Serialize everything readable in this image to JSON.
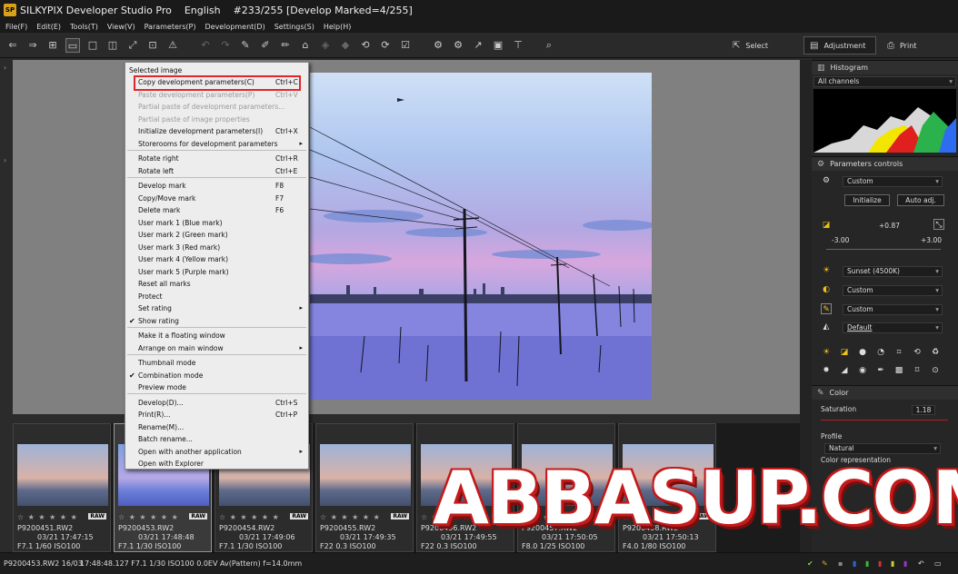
{
  "window": {
    "title": "SILKYPIX Developer Studio Pro",
    "language": "English",
    "image_info": "#233/255 [Develop Marked=4/255]"
  },
  "menubar": [
    "File(F)",
    "Edit(E)",
    "Tools(T)",
    "View(V)",
    "Parameters(P)",
    "Development(D)",
    "Settings(S)",
    "Help(H)"
  ],
  "toolbar": {
    "select_label": "Select",
    "adjustment_label": "Adjustment",
    "print_label": "Print"
  },
  "context_menu": {
    "header": "Selected image",
    "items": [
      {
        "label": "Copy development parameters(C)",
        "shortcut": "Ctrl+C",
        "enabled": true,
        "highlighted": true
      },
      {
        "label": "Paste development parameters(P)",
        "shortcut": "Ctrl+V",
        "enabled": false
      },
      {
        "label": "Partial paste of development parameters...",
        "shortcut": "",
        "enabled": false
      },
      {
        "label": "Partial paste of image properties",
        "shortcut": "",
        "enabled": false
      },
      {
        "label": "Initialize development parameters(I)",
        "shortcut": "Ctrl+X",
        "enabled": true
      },
      {
        "label": "Storerooms for development parameters",
        "shortcut": "",
        "enabled": true,
        "submenu": true
      },
      {
        "label": "Rotate right",
        "shortcut": "Ctrl+R",
        "enabled": true
      },
      {
        "label": "Rotate left",
        "shortcut": "Ctrl+E",
        "enabled": true
      },
      {
        "label": "Develop mark",
        "shortcut": "F8",
        "enabled": true
      },
      {
        "label": "Copy/Move mark",
        "shortcut": "F7",
        "enabled": true
      },
      {
        "label": "Delete mark",
        "shortcut": "F6",
        "enabled": true
      },
      {
        "label": "User mark 1 (Blue mark)",
        "shortcut": "",
        "enabled": true
      },
      {
        "label": "User mark 2 (Green mark)",
        "shortcut": "",
        "enabled": true
      },
      {
        "label": "User mark 3 (Red mark)",
        "shortcut": "",
        "enabled": true
      },
      {
        "label": "User mark 4 (Yellow mark)",
        "shortcut": "",
        "enabled": true
      },
      {
        "label": "User mark 5 (Purple mark)",
        "shortcut": "",
        "enabled": true
      },
      {
        "label": "Reset all marks",
        "shortcut": "",
        "enabled": true
      },
      {
        "label": "Protect",
        "shortcut": "",
        "enabled": true
      },
      {
        "label": "Set rating",
        "shortcut": "",
        "enabled": true,
        "submenu": true
      },
      {
        "label": "Show rating",
        "shortcut": "",
        "enabled": true,
        "checked": true
      },
      {
        "label": "Make it a floating window",
        "shortcut": "",
        "enabled": true
      },
      {
        "label": "Arrange on main window",
        "shortcut": "",
        "enabled": true,
        "submenu": true
      },
      {
        "label": "Thumbnail mode",
        "shortcut": "",
        "enabled": true
      },
      {
        "label": "Combination mode",
        "shortcut": "",
        "enabled": true,
        "checked": true
      },
      {
        "label": "Preview mode",
        "shortcut": "",
        "enabled": true
      },
      {
        "label": "Develop(D)...",
        "shortcut": "Ctrl+S",
        "enabled": true
      },
      {
        "label": "Print(R)...",
        "shortcut": "Ctrl+P",
        "enabled": true
      },
      {
        "label": "Rename(M)...",
        "shortcut": "",
        "enabled": true
      },
      {
        "label": "Batch rename...",
        "shortcut": "",
        "enabled": true
      },
      {
        "label": "Open with another application",
        "shortcut": "",
        "enabled": true,
        "submenu": true
      },
      {
        "label": "Open with Explorer",
        "shortcut": "",
        "enabled": true
      }
    ]
  },
  "filmstrip": [
    {
      "name": "P9200451.RW2",
      "date": "03/21 17:47:15",
      "exif": "F7.1 1/60 ISO100",
      "selected": false
    },
    {
      "name": "P9200453.RW2",
      "date": "03/21 17:48:48",
      "exif": "F7.1 1/30 ISO100",
      "selected": true
    },
    {
      "name": "P9200454.RW2",
      "date": "03/21 17:49:06",
      "exif": "F7.1 1/30 ISO100",
      "selected": false
    },
    {
      "name": "P9200455.RW2",
      "date": "03/21 17:49:35",
      "exif": "F22 0.3 ISO100",
      "selected": false
    },
    {
      "name": "P9200456.RW2",
      "date": "03/21 17:49:55",
      "exif": "F22 0.3 ISO100",
      "selected": false
    },
    {
      "name": "P9200457.RW2",
      "date": "03/21 17:50:05",
      "exif": "F8.0 1/25 ISO100",
      "selected": false
    },
    {
      "name": "P9200458.RW2",
      "date": "03/21 17:50:13",
      "exif": "F4.0 1/80 ISO100",
      "selected": false
    }
  ],
  "raw_badge": "RAW",
  "stars": "☆ ★ ★ ★ ★ ★",
  "panel": {
    "histogram_title": "Histogram",
    "channels": "All channels",
    "params_title": "Parameters controls",
    "preset": "Custom",
    "initialize_label": "Initialize",
    "auto_adj_label": "Auto adj.",
    "exposure_value": "+0.87",
    "exposure_min": "-3.00",
    "exposure_max": "+3.00",
    "white_balance": "Sunset (4500K)",
    "tone": "Custom",
    "sharpness": "Custom",
    "default_label": "Default",
    "color_title": "Color",
    "saturation_label": "Saturation",
    "saturation_value": "1.18",
    "profile_label": "Profile",
    "profile_value": "Natural",
    "color_repr_label": "Color representation"
  },
  "statusbar": {
    "file": "P9200453.RW2 16/03",
    "info": "17:48:48.127 F7.1 1/30 ISO100 0.0EV Av(Pattern) f=14.0mm"
  },
  "watermark": "ABBASUP.COM",
  "colors": {
    "highlight_border": "#e0262a",
    "watermark_shadow": "#c41a1a"
  }
}
